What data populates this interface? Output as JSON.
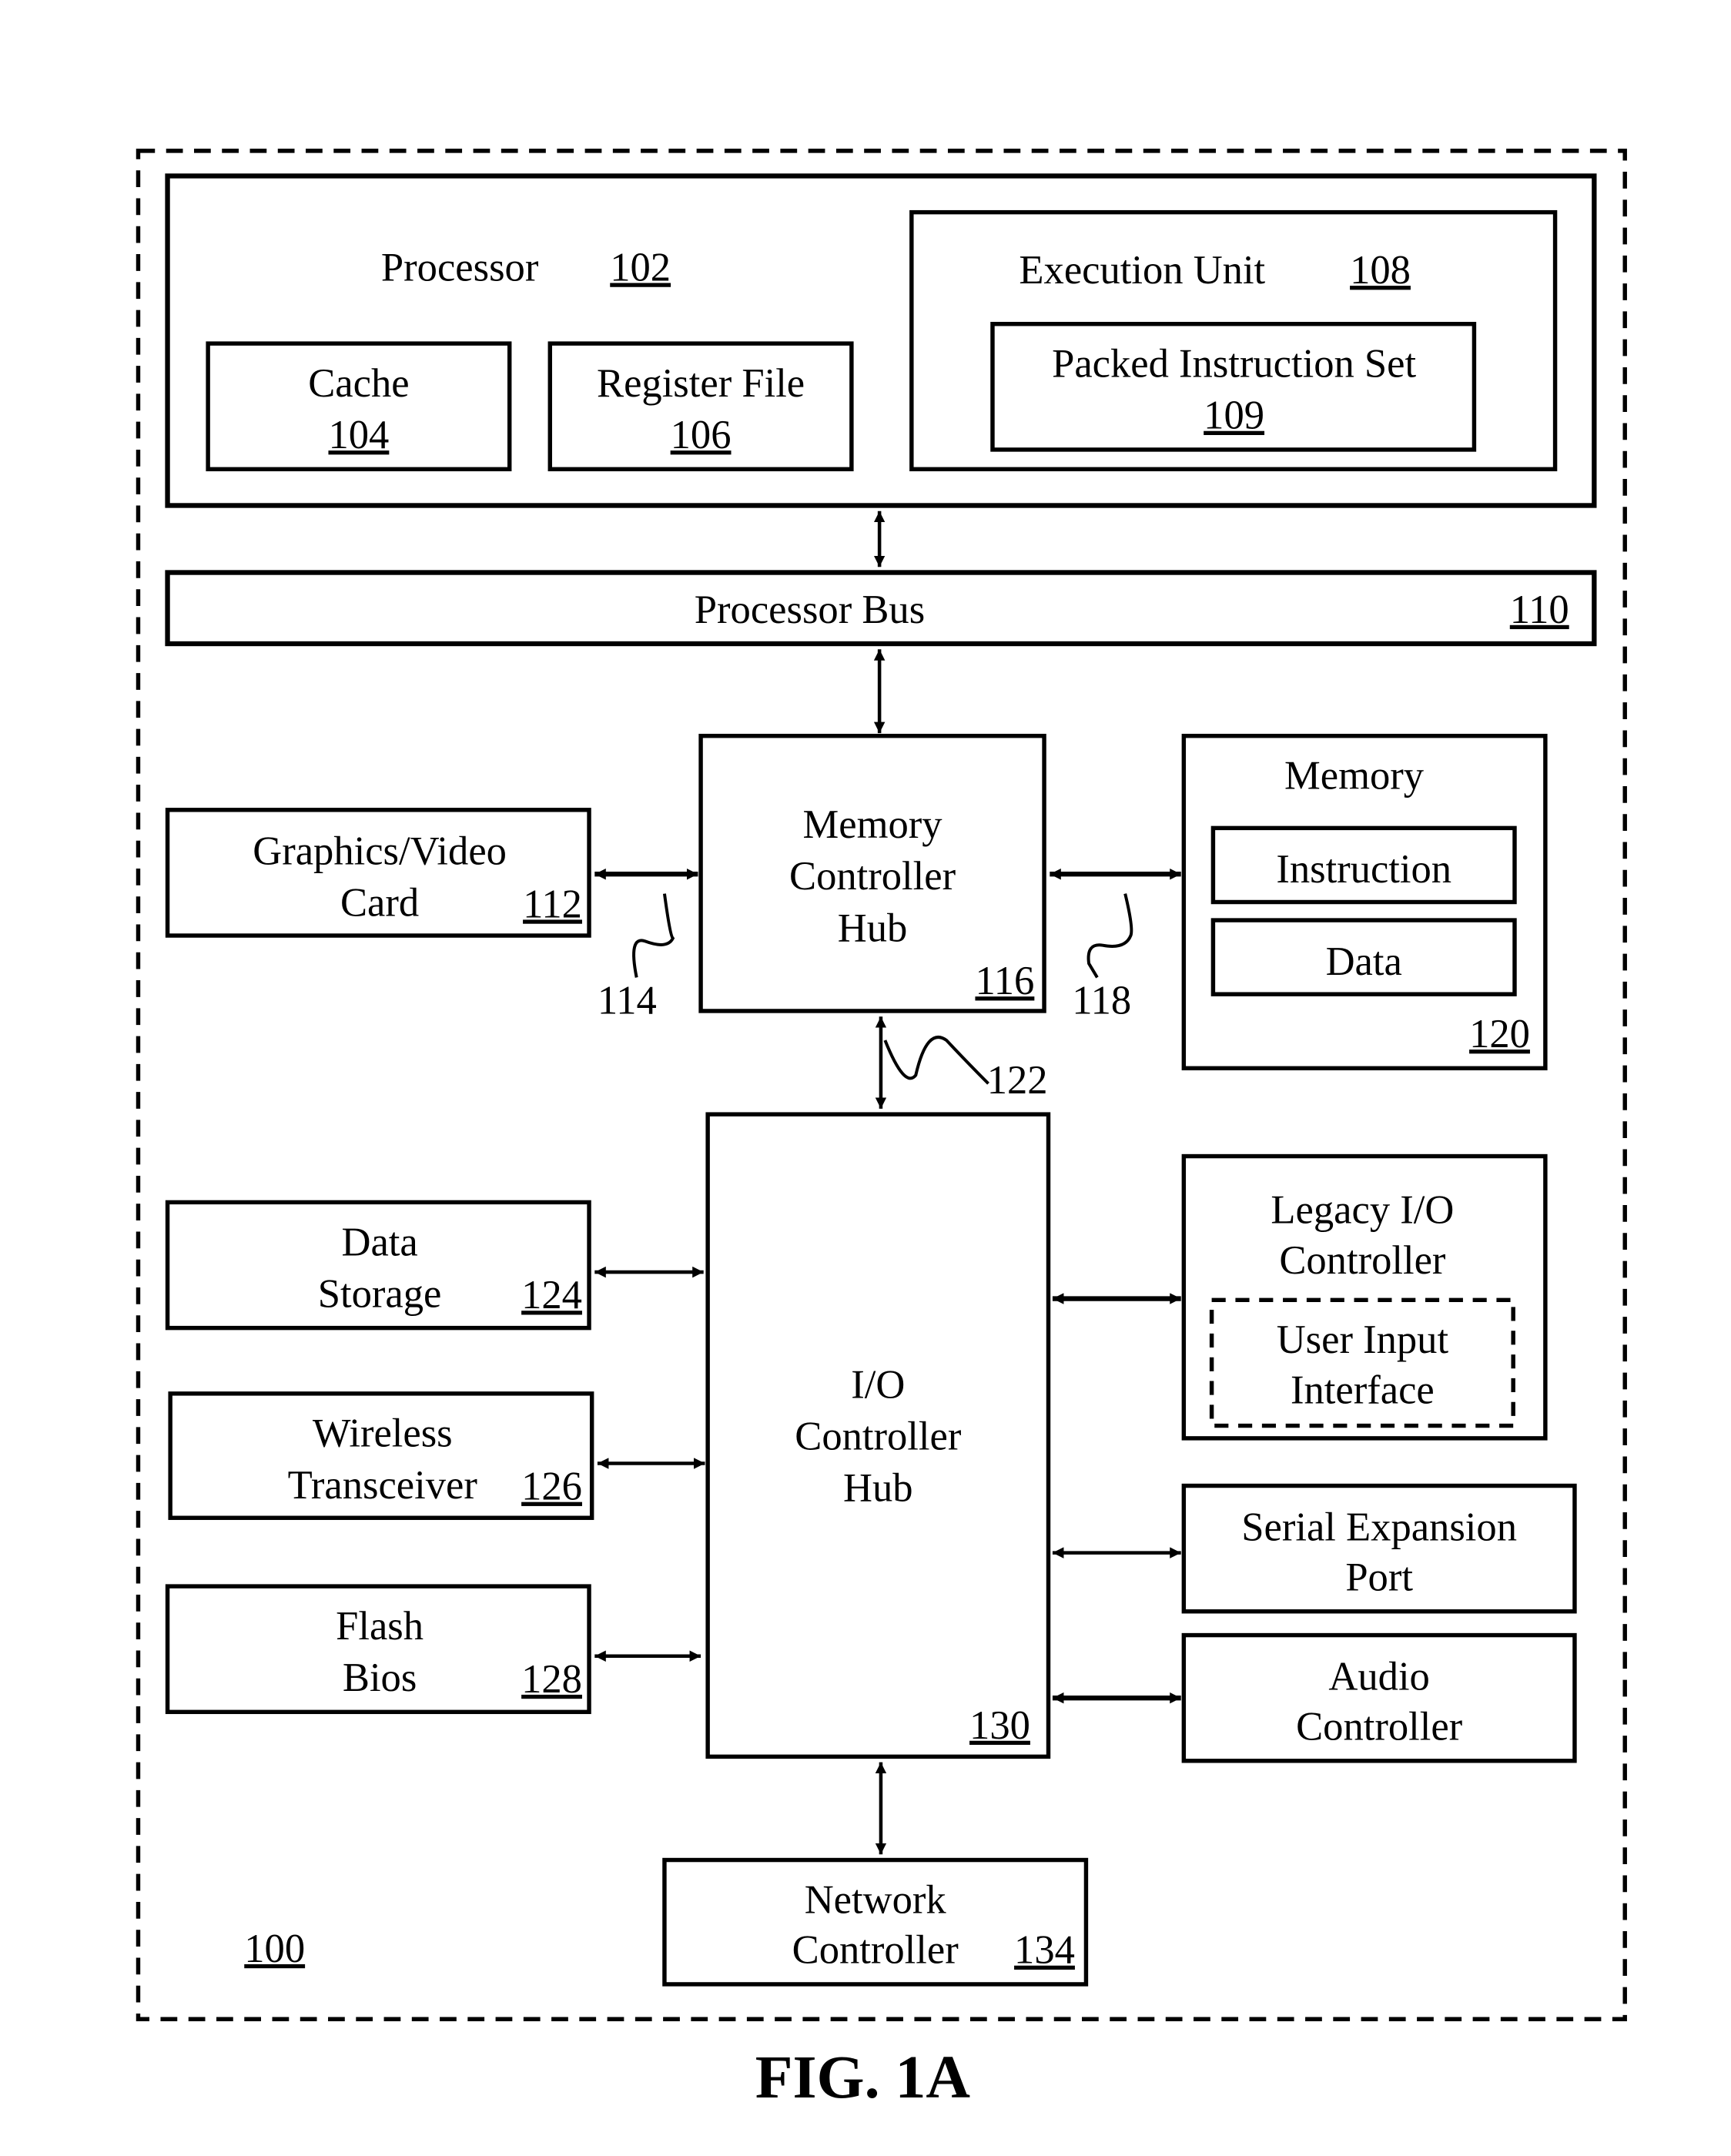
{
  "figure": {
    "caption": "FIG. 1A",
    "system_ref": "100"
  },
  "processor": {
    "label": "Processor",
    "ref": "102",
    "cache": {
      "label": "Cache",
      "ref": "104"
    },
    "register_file": {
      "label": "Register File",
      "ref": "106"
    },
    "execution_unit": {
      "label": "Execution Unit",
      "ref": "108",
      "packed_instruction_set": {
        "label": "Packed Instruction Set",
        "ref": "109"
      }
    }
  },
  "processor_bus": {
    "label": "Processor Bus",
    "ref": "110"
  },
  "graphics_card": {
    "line1": "Graphics/Video",
    "line2": "Card",
    "ref": "112"
  },
  "link_114": "114",
  "memory_controller_hub": {
    "line1": "Memory",
    "line2": "Controller",
    "line3": "Hub",
    "ref": "116"
  },
  "link_118": "118",
  "memory": {
    "label": "Memory",
    "instruction": "Instruction",
    "data": "Data",
    "ref": "120"
  },
  "link_122": "122",
  "data_storage": {
    "line1": "Data",
    "line2": "Storage",
    "ref": "124"
  },
  "wireless_transceiver": {
    "line1": "Wireless",
    "line2": "Transceiver",
    "ref": "126"
  },
  "flash_bios": {
    "line1": "Flash",
    "line2": "Bios",
    "ref": "128"
  },
  "io_controller_hub": {
    "line1": "I/O",
    "line2": "Controller",
    "line3": "Hub",
    "ref": "130"
  },
  "legacy_io": {
    "line1": "Legacy I/O",
    "line2": "Controller",
    "ui_line1": "User Input",
    "ui_line2": "Interface"
  },
  "serial_expansion": {
    "line1": "Serial Expansion",
    "line2": "Port"
  },
  "audio_controller": {
    "line1": "Audio",
    "line2": "Controller"
  },
  "network_controller": {
    "line1": "Network",
    "line2": "Controller",
    "ref": "134"
  }
}
